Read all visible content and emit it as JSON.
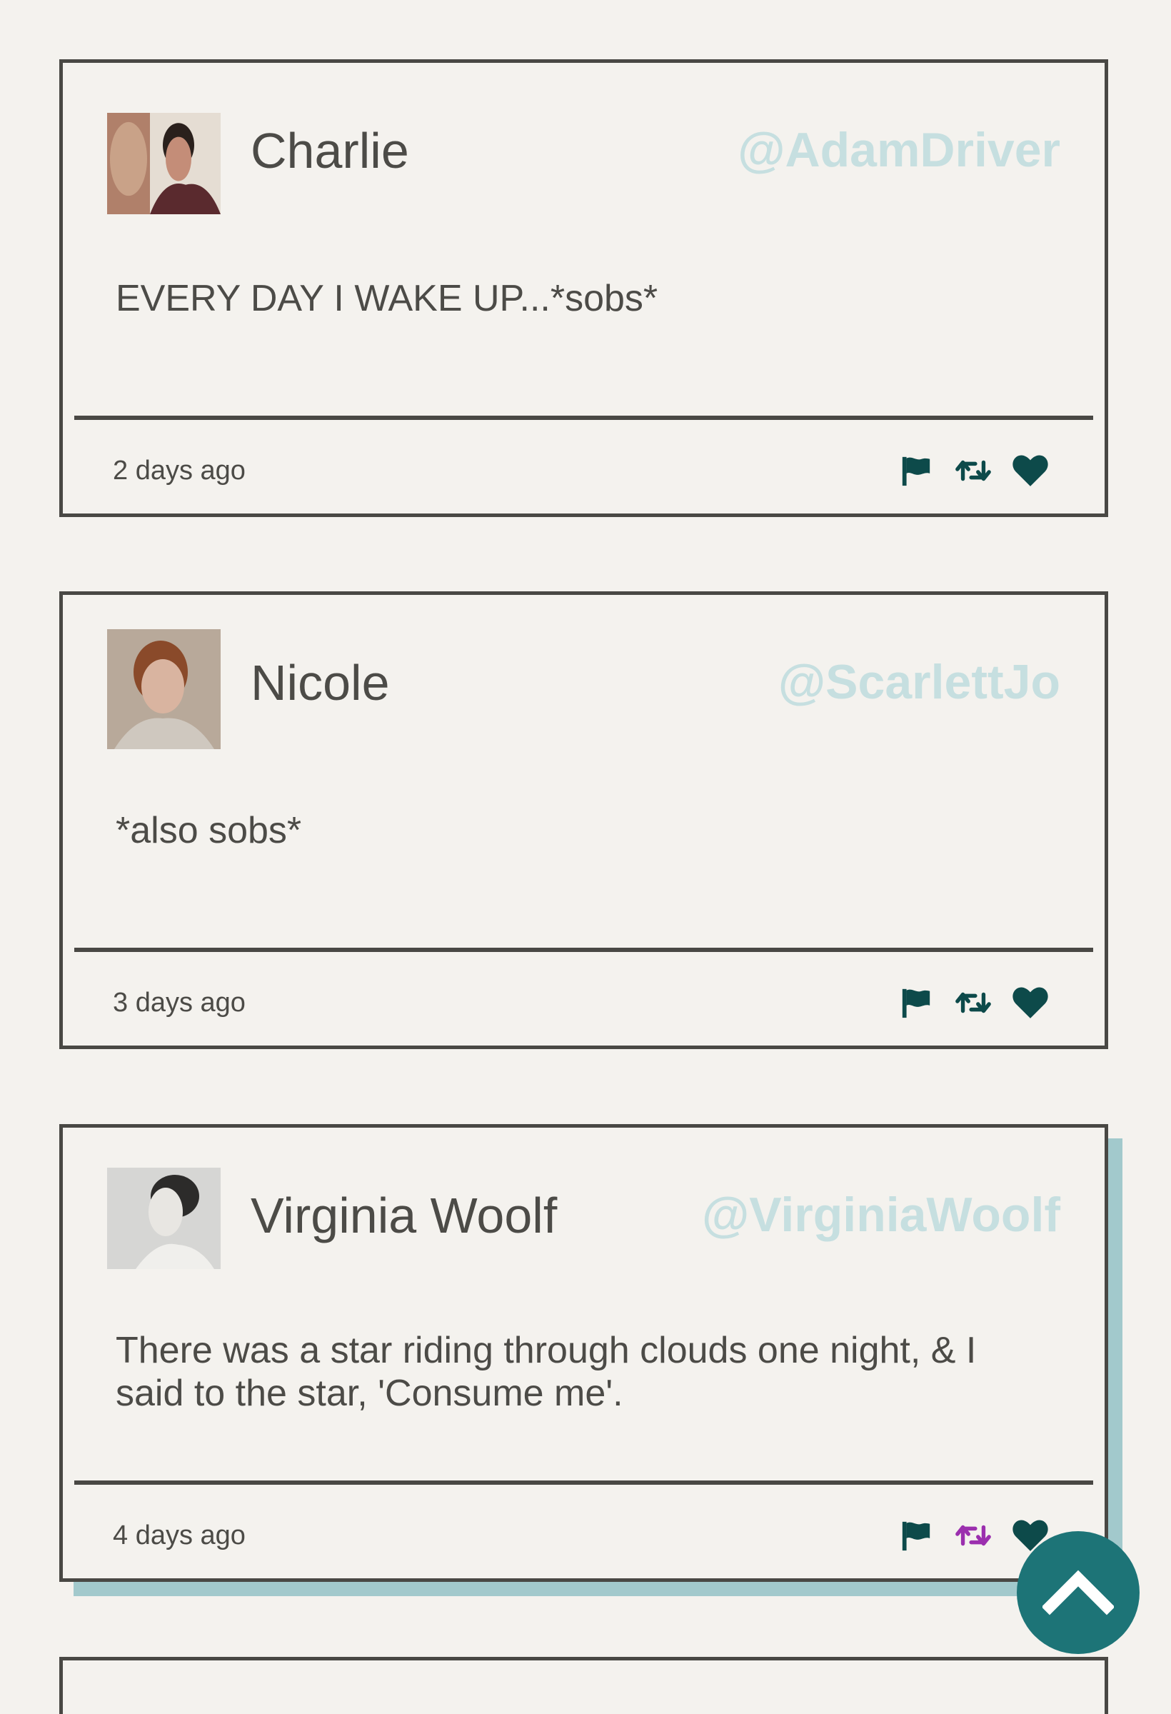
{
  "colors": {
    "background": "#f4f2ee",
    "card_border": "#494844",
    "handle": "#c6dfe0",
    "action_icon": "#0d4a4a",
    "retweet_active": "#9b2fae",
    "card_shadow": "#a2c9cc",
    "scroll_button": "#1d7477"
  },
  "tweets": [
    {
      "name": "Charlie",
      "handle": "@AdamDriver",
      "text": "EVERY DAY I WAKE UP...*sobs*",
      "time": "2 days ago",
      "retweeted": false,
      "avatar_icon": "avatar-photo"
    },
    {
      "name": "Nicole",
      "handle": "@ScarlettJo",
      "text": "*also sobs*",
      "time": "3 days ago",
      "retweeted": false,
      "avatar_icon": "avatar-photo"
    },
    {
      "name": "Virginia Woolf",
      "handle": "@VirginiaWoolf",
      "text": "There was a star riding through clouds one night, & I said to the star, 'Consume me'.",
      "time": "4 days ago",
      "retweeted": true,
      "avatar_icon": "avatar-photo"
    }
  ],
  "icons": {
    "flag": "flag-icon",
    "retweet": "retweet-icon",
    "like": "heart-icon",
    "scroll_top": "chevron-up-icon"
  }
}
